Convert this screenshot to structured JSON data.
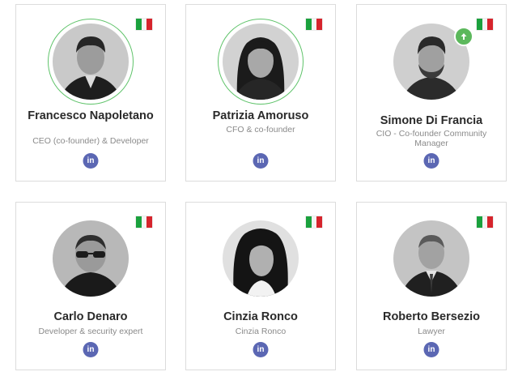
{
  "colors": {
    "ring": "#5fc36a",
    "linkedin": "#5b67b3",
    "name": "#2a2a2a",
    "role": "#8a8a8a",
    "badge": "#5cb85c",
    "flag": [
      "#1aa13d",
      "#f4f4f4",
      "#d6242c"
    ]
  },
  "icons": {
    "flag": "italian-flag-icon",
    "linkedin": "linkedin-icon",
    "badge": "arrow-up-icon"
  },
  "linkedin_label": "in",
  "team": [
    {
      "name": "Francesco Napoletano",
      "role": "CEO (co-founder) & Developer"
    },
    {
      "name": "Patrizia Amoruso",
      "role": "CFO & co-founder"
    },
    {
      "name": "Simone Di Francia",
      "role": "CIO - Co-founder Community Manager"
    },
    {
      "name": "Carlo Denaro",
      "role": "Developer & security expert"
    },
    {
      "name": "Cinzia Ronco",
      "role": "Cinzia Ronco"
    },
    {
      "name": "Roberto Bersezio",
      "role": "Lawyer"
    }
  ]
}
